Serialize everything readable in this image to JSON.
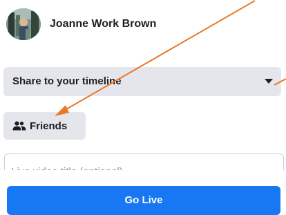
{
  "composer": {
    "user_name": "Joanne Work Brown",
    "avatar_icon": "profile-photo",
    "share_target": {
      "selected": "Share to your timeline",
      "icon": "caret-down-icon"
    },
    "audience": {
      "label": "Friends",
      "icon": "friends-icon"
    },
    "title_input": {
      "value": "",
      "placeholder": "Live video title (optional)"
    },
    "go_live": {
      "label": "Go Live"
    }
  },
  "colors": {
    "primary_button": "#1877f2",
    "secondary_fill": "#e4e6eb",
    "text": "#1c1e21",
    "annotation_arrow": "#e8782a"
  }
}
